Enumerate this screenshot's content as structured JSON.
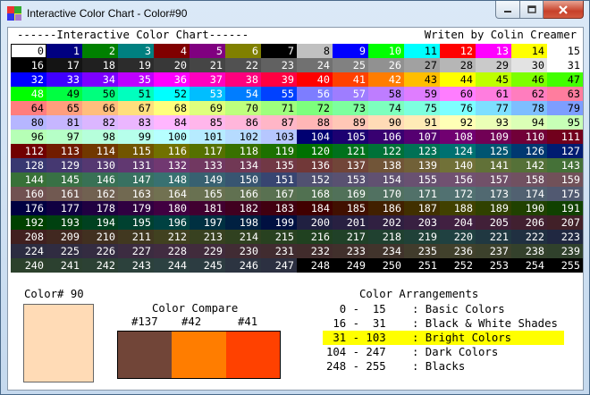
{
  "window": {
    "title": "Interactive Color Chart - Color#90",
    "caption": {
      "min": "minimize",
      "max": "maximize",
      "close": "close"
    }
  },
  "header": {
    "left": "------Interactive Color Chart------",
    "right": "Writen by Colin Creamer"
  },
  "palette": [
    "#ffffff",
    "#000080",
    "#008000",
    "#008080",
    "#800000",
    "#800080",
    "#808000",
    "#000000",
    "#c0c0c0",
    "#0000ff",
    "#00ff00",
    "#00ffff",
    "#ff0000",
    "#ff00ff",
    "#ffff00",
    "#ffffff",
    "#000000",
    "#141414",
    "#202020",
    "#2c2c2c",
    "#383838",
    "#454545",
    "#515151",
    "#616161",
    "#717171",
    "#818181",
    "#919191",
    "#a1a1a1",
    "#b6b6b6",
    "#cacaca",
    "#e3e3e3",
    "#ffffff",
    "#0000ff",
    "#4000ff",
    "#7d00ff",
    "#be00ff",
    "#ff00ff",
    "#ff00be",
    "#ff007d",
    "#ff0041",
    "#ff0000",
    "#ff4100",
    "#ff7d00",
    "#ffbe00",
    "#ffff00",
    "#beff00",
    "#7dff00",
    "#41ff00",
    "#00ff00",
    "#00ff41",
    "#00ff7d",
    "#00ffbe",
    "#00ffff",
    "#00beff",
    "#007dff",
    "#0041ff",
    "#7d7dff",
    "#9e7dff",
    "#be7dff",
    "#df7dff",
    "#ff7dff",
    "#ff7ddf",
    "#ff7dbe",
    "#ff7d9e",
    "#ff7d7d",
    "#ff9e7d",
    "#ffbe7d",
    "#ffdf7d",
    "#ffff7d",
    "#dfff7d",
    "#beff7d",
    "#9eff7d",
    "#7dff7d",
    "#7dff9e",
    "#7dffbe",
    "#7dffdf",
    "#7dffff",
    "#7ddfff",
    "#7dbeff",
    "#7d9eff",
    "#b6b6ff",
    "#c6b6ff",
    "#dbb6ff",
    "#ebb6ff",
    "#ffb6ff",
    "#ffb6eb",
    "#ffb6db",
    "#ffb6c7",
    "#ffb6b6",
    "#ffc7b6",
    "#ffdbb6",
    "#ffebb6",
    "#ffffb6",
    "#ebffb6",
    "#dbffb6",
    "#c7ffb6",
    "#b6ffb6",
    "#b6ffc7",
    "#b6ffdb",
    "#b6ffeb",
    "#b6ffff",
    "#b6ebff",
    "#b6dbff",
    "#b6c7ff",
    "#000071",
    "#1c0071",
    "#380071",
    "#550071",
    "#710071",
    "#710055",
    "#710038",
    "#71001c",
    "#710000",
    "#711c00",
    "#713800",
    "#715500",
    "#717100",
    "#557100",
    "#387100",
    "#1c7100",
    "#007100",
    "#00711c",
    "#007138",
    "#007155",
    "#007171",
    "#005571",
    "#003871",
    "#001c71",
    "#383871",
    "#453871",
    "#553871",
    "#613871",
    "#713871",
    "#713861",
    "#713855",
    "#713845",
    "#713838",
    "#714538",
    "#715538",
    "#716138",
    "#717138",
    "#617138",
    "#557138",
    "#457138",
    "#387138",
    "#387145",
    "#387155",
    "#387161",
    "#387171",
    "#386171",
    "#385571",
    "#384571",
    "#515171",
    "#595171",
    "#615171",
    "#695171",
    "#715171",
    "#715169",
    "#715161",
    "#715159",
    "#715151",
    "#715951",
    "#716151",
    "#716951",
    "#717151",
    "#697151",
    "#617151",
    "#597151",
    "#517151",
    "#517159",
    "#517161",
    "#517169",
    "#517171",
    "#516971",
    "#516171",
    "#515971",
    "#000041",
    "#100041",
    "#200041",
    "#300041",
    "#410041",
    "#410030",
    "#410020",
    "#410010",
    "#410000",
    "#411000",
    "#412000",
    "#413000",
    "#414100",
    "#304100",
    "#204100",
    "#104100",
    "#004100",
    "#004110",
    "#004120",
    "#004130",
    "#004141",
    "#003041",
    "#002041",
    "#001041",
    "#202041",
    "#282041",
    "#302041",
    "#382041",
    "#412041",
    "#412038",
    "#412030",
    "#412028",
    "#412020",
    "#412820",
    "#413020",
    "#413820",
    "#414120",
    "#384120",
    "#304120",
    "#284120",
    "#204120",
    "#204128",
    "#204130",
    "#204138",
    "#204141",
    "#203841",
    "#203041",
    "#202841",
    "#2c2c41",
    "#302c41",
    "#342c41",
    "#3c2c41",
    "#412c41",
    "#412c3c",
    "#412c34",
    "#412c30",
    "#412c2c",
    "#41302c",
    "#41342c",
    "#413c2c",
    "#41412c",
    "#3c412c",
    "#34412c",
    "#30412c",
    "#2c412c",
    "#2c4130",
    "#2c4134",
    "#2c413c",
    "#2c4141",
    "#2c3c41",
    "#2c3441",
    "#2c3041",
    "#000000",
    "#000000",
    "#000000",
    "#000000",
    "#000000",
    "#000000",
    "#000000",
    "#000000"
  ],
  "selection": {
    "label": "Color# 90",
    "color": "#ffdbb6"
  },
  "compare": {
    "title": "Color Compare",
    "labels": [
      "#137",
      "#42",
      "#41"
    ],
    "colors": [
      "#714538",
      "#ff7d00",
      "#ff4100"
    ]
  },
  "arrangements": {
    "title": "Color Arrangements",
    "highlight": "#ffff00",
    "rows": [
      {
        "range": "  0 -  15",
        "name": ": Basic Colors"
      },
      {
        "range": " 16 -  31",
        "name": ": Black & White Shades"
      },
      {
        "range": " 31 - 103",
        "name": ": Bright Colors"
      },
      {
        "range": "104 - 247",
        "name": ": Dark Colors"
      },
      {
        "range": "248 - 255",
        "name": ": Blacks"
      }
    ],
    "active_index": 2
  }
}
